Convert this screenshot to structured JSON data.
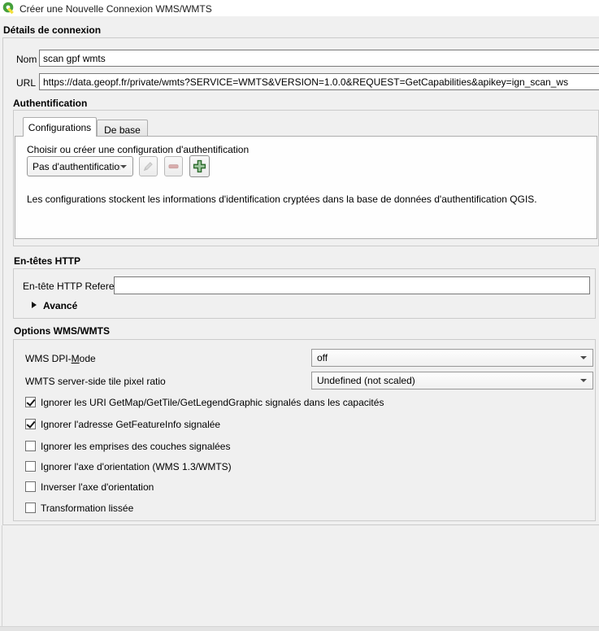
{
  "window": {
    "title": "Créer une Nouvelle Connexion WMS/WMTS",
    "icon": "qgis-logo-icon"
  },
  "connection_details": {
    "title": "Détails de connexion",
    "name_label": "Nom",
    "name_value": "scan gpf wmts",
    "url_label": "URL",
    "url_value": "https://data.geopf.fr/private/wmts?SERVICE=WMTS&VERSION=1.0.0&REQUEST=GetCapabilities&apikey=ign_scan_ws"
  },
  "authentication": {
    "title": "Authentification",
    "tabs": [
      {
        "label": "Configurations",
        "active": true
      },
      {
        "label": "De base",
        "active": false
      }
    ],
    "choose_label": "Choisir ou créer une configuration d'authentification",
    "config_select_value": "Pas d'authentification",
    "buttons": [
      {
        "name": "edit-config-button",
        "icon": "pencil-icon",
        "enabled": false
      },
      {
        "name": "remove-config-button",
        "icon": "minus-icon",
        "enabled": false
      },
      {
        "name": "add-config-button",
        "icon": "plus-icon",
        "enabled": true
      }
    ],
    "info_text": "Les configurations stockent les informations d'identification cryptées dans la base de données d'authentification QGIS."
  },
  "http_headers": {
    "title": "En-têtes HTTP",
    "referer_label": "En-tête HTTP Referer",
    "referer_value": "",
    "advanced_label": "Avancé"
  },
  "wms_options": {
    "title": "Options WMS/WMTS",
    "dpi_mode": {
      "label_pre": "WMS DPI-",
      "label_mnemonic": "M",
      "label_post": "ode",
      "value": "off"
    },
    "tile_ratio": {
      "label": "WMTS server-side tile pixel ratio",
      "value": "Undefined (not scaled)"
    },
    "checkboxes": [
      {
        "label": "Ignorer les URI GetMap/GetTile/GetLegendGraphic signalés dans les capacités",
        "checked": true
      },
      {
        "label": "Ignorer l'adresse GetFeatureInfo signalée",
        "checked": true
      },
      {
        "label": "Ignorer les emprises des couches signalées",
        "checked": false
      },
      {
        "label": "Ignorer l'axe d'orientation (WMS 1.3/WMTS)",
        "checked": false
      },
      {
        "label": "Inverser l'axe d'orientation",
        "checked": false
      },
      {
        "label": "Transformation lissée",
        "checked": false
      }
    ]
  },
  "colors": {
    "background": "#f0f0f0",
    "titlebar": "#ffffff",
    "accent_green": "#2d6b2d",
    "logo_green": "#45a03c",
    "logo_yellow": "#f3e03c",
    "disabled_red": "#d4a0a0"
  }
}
